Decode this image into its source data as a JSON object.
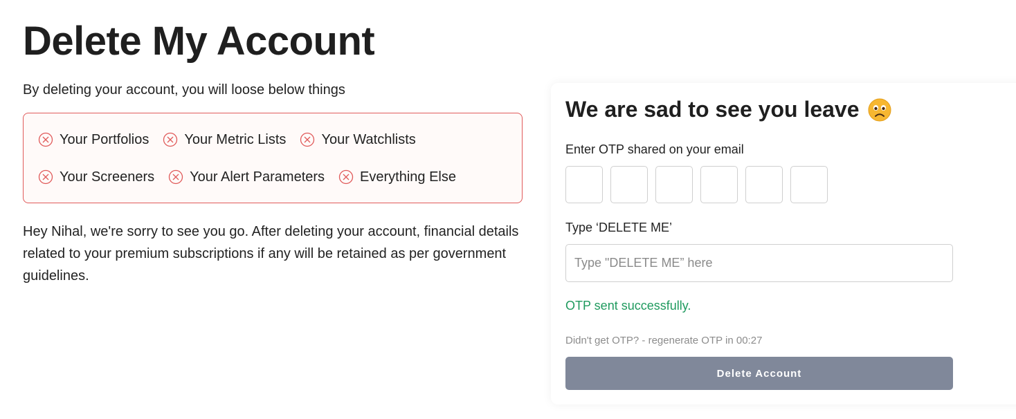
{
  "page": {
    "title": "Delete My Account",
    "intro": "By deleting your account, you will loose below things",
    "loss_rows": [
      [
        "Your Portfolios",
        "Your Metric Lists",
        "Your Watchlists"
      ],
      [
        "Your Screeners",
        "Your Alert Parameters",
        "Everything Else"
      ]
    ],
    "message": "Hey Nihal, we're sorry to see you go. After deleting your account, financial details related to your premium subscriptions if any will be retained as per government guidelines."
  },
  "card": {
    "title": "We are sad to see you leave",
    "title_icon": "sad-face-icon",
    "otp_label": "Enter OTP shared on your email",
    "otp_values": [
      "",
      "",
      "",
      "",
      "",
      ""
    ],
    "confirm_label": "Type ‘DELETE ME’",
    "confirm_value": "",
    "confirm_placeholder": "Type \"DELETE ME” here",
    "status": "OTP sent successfully.",
    "regenerate": "Didn't get OTP? - regenerate OTP in 00:27",
    "delete_button": "Delete Account"
  },
  "colors": {
    "loss_border": "#e05a5a",
    "loss_icon": "#e05a5a",
    "success": "#1f9a5e",
    "button_bg": "#80889a"
  }
}
